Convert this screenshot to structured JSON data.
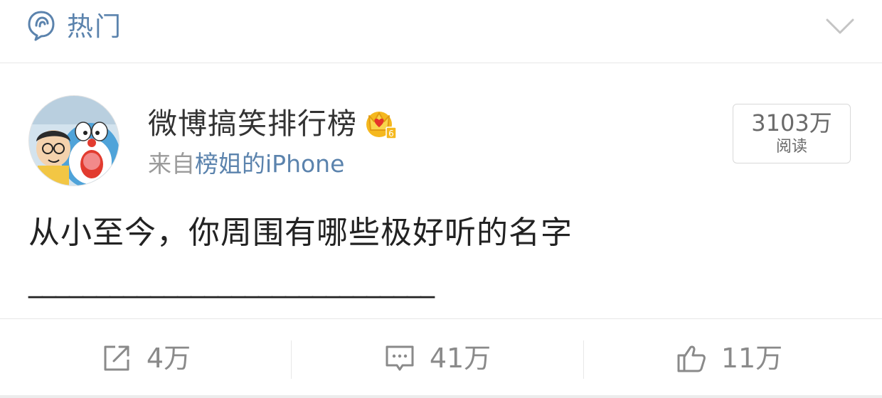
{
  "header": {
    "label": "热门",
    "icons": {
      "hot": "hot-bubble-icon",
      "expand": "chevron-down-icon"
    }
  },
  "post": {
    "author": "微博搞笑排行榜",
    "source_prefix": "来自",
    "source_name": "榜姐的iPhone",
    "read_count": "3103万",
    "read_label": "阅读",
    "text": "从小至今，你周围有哪些极好听的名字",
    "underline": "______________________________",
    "badge_icon": "vip-crown-icon"
  },
  "actions": [
    {
      "icon": "repost-icon",
      "count": "4万"
    },
    {
      "icon": "comment-icon",
      "count": "41万"
    },
    {
      "icon": "like-icon",
      "count": "11万"
    }
  ],
  "colors": {
    "accent": "#5b83ad",
    "text": "#222222",
    "muted": "#9b9b9b",
    "divider": "#e6e6e6"
  }
}
